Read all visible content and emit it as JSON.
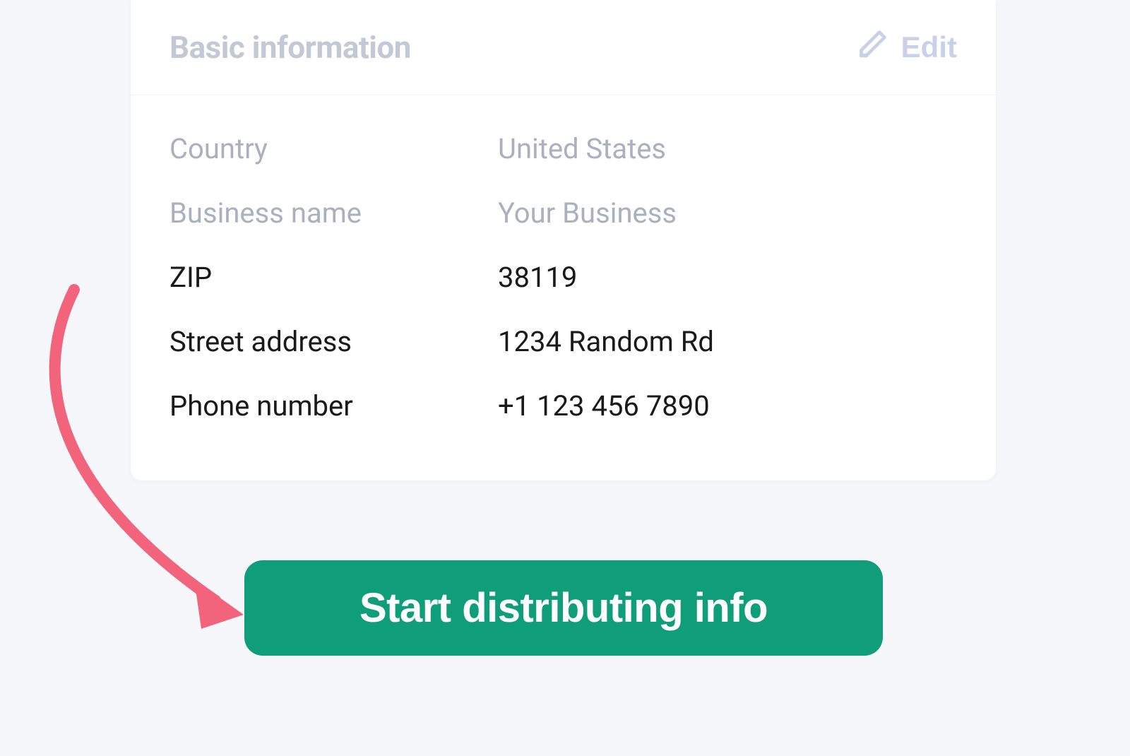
{
  "card": {
    "title": "Basic information",
    "edit_label": "Edit",
    "rows": [
      {
        "label": "Country",
        "value": "United States",
        "faded": true
      },
      {
        "label": "Business name",
        "value": "Your Business",
        "faded": true
      },
      {
        "label": "ZIP",
        "value": "38119",
        "faded": false
      },
      {
        "label": "Street address",
        "value": "1234 Random Rd",
        "faded": false
      },
      {
        "label": "Phone number",
        "value": "+1 123 456 7890",
        "faded": false
      }
    ]
  },
  "cta": {
    "label": "Start distributing info"
  },
  "colors": {
    "cta_bg": "#0f9d7a",
    "arrow": "#f2647c"
  }
}
